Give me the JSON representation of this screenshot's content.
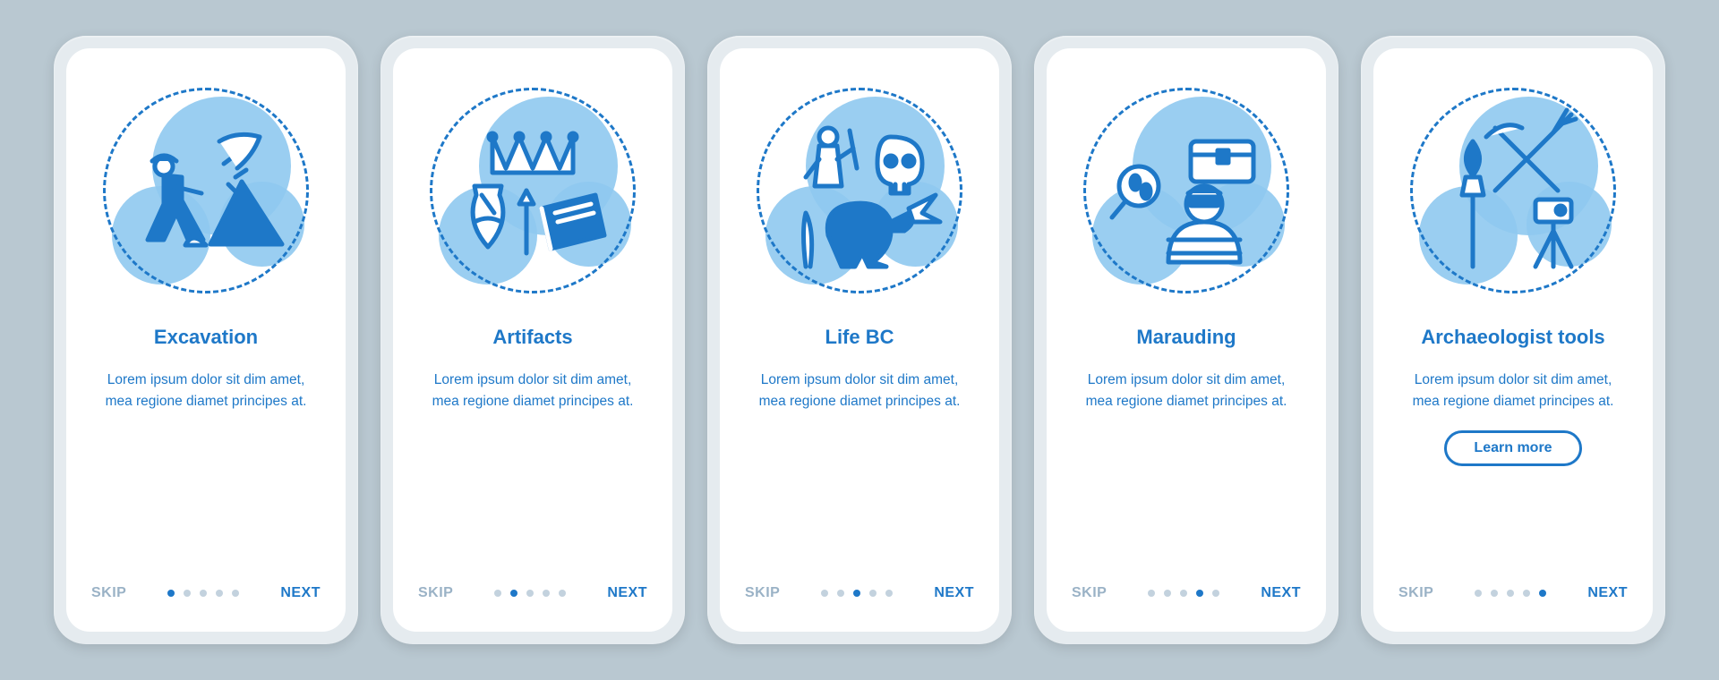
{
  "nav": {
    "skip": "SKIP",
    "next": "NEXT",
    "total_dots": 5
  },
  "cta": {
    "learn_more": "Learn more"
  },
  "colors": {
    "primary": "#1e78c8",
    "muted": "#9ab2c6",
    "bg": "#b9c8d1",
    "blob": "#8fc9ef"
  },
  "icons": {
    "excavation": "excavation-icon",
    "artifacts": "artifacts-icon",
    "life_bc": "life-bc-icon",
    "marauding": "marauding-icon",
    "tools": "archaeologist-tools-icon"
  },
  "screens": [
    {
      "title": "Excavation",
      "desc": "Lorem ipsum dolor sit dim amet, mea regione diamet principes at.",
      "active_dot": 0
    },
    {
      "title": "Artifacts",
      "desc": "Lorem ipsum dolor sit dim amet, mea regione diamet principes at.",
      "active_dot": 1
    },
    {
      "title": "Life BC",
      "desc": "Lorem ipsum dolor sit dim amet, mea regione diamet principes at.",
      "active_dot": 2
    },
    {
      "title": "Marauding",
      "desc": "Lorem ipsum dolor sit dim amet, mea regione diamet principes at.",
      "active_dot": 3
    },
    {
      "title": "Archaeologist tools",
      "desc": "Lorem ipsum dolor sit dim amet, mea regione diamet principes at.",
      "active_dot": 4,
      "has_cta": true
    }
  ]
}
